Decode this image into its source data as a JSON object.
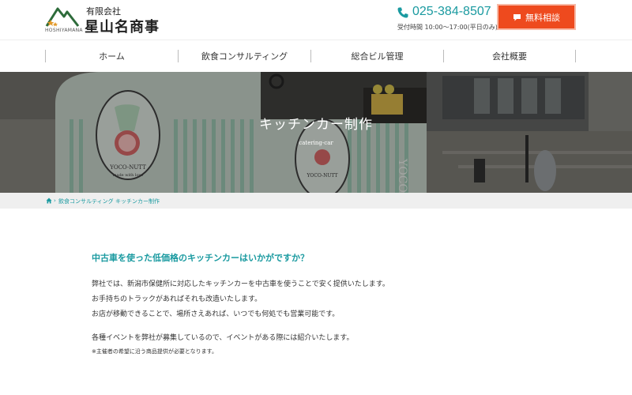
{
  "header": {
    "logo_latin": "HOSHIYAMANA",
    "company_type": "有限会社",
    "company_name": "星山名商事",
    "phone": "025-384-8507",
    "hours": "受付時間 10:00～17:00(平日のみ)",
    "consult_label": "無料相談",
    "accent_color": "#1a9aa0",
    "button_color": "#ee4a1e"
  },
  "nav": {
    "items": [
      {
        "label": "ホーム"
      },
      {
        "label": "飲食コンサルティング"
      },
      {
        "label": "総合ビル管理"
      },
      {
        "label": "会社概要"
      }
    ]
  },
  "hero": {
    "title": "キッチンカー制作",
    "subtitle": "catering-car",
    "sign_text": "YOCO-NUTT",
    "sign_sub": "made with love",
    "window_text": "YOCO-NUT"
  },
  "breadcrumb": {
    "items": [
      "飲食コンサルティング",
      "キッチンカー制作"
    ]
  },
  "main": {
    "heading": "中古車を使った低価格のキッチンカーはいかがですか？",
    "paragraphs": [
      "弊社では、新潟市保健所に対応したキッチンカーを中古車を使うことで安く提供いたします。",
      "お手持ちのトラックがあればそれも改造いたします。",
      "お店が移動できることで、場所さえあれば、いつでも何処でも営業可能です。",
      "各種イベントを弊社が募集しているので、イベントがある際には紹介いたします。"
    ],
    "note": "※主催者の希望に沿う商品提供が必要となります。"
  }
}
